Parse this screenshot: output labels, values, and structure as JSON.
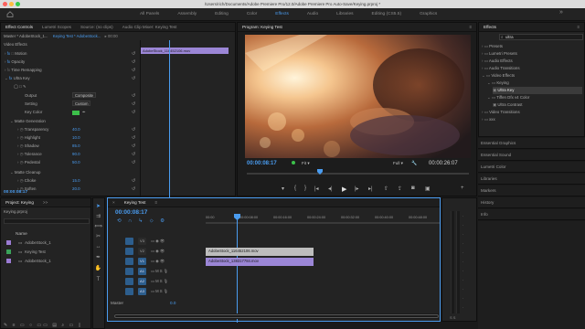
{
  "window": {
    "title": "/Users/rich/Documents/Adobe Premiere Pro/12.0/Adobe Premiere Pro Auto-Save/Keying.prproj *"
  },
  "workspaces": [
    "All Panels",
    "Assembly",
    "Editing",
    "Color",
    "Effects",
    "Audio",
    "Libraries",
    "Editing (CS5.5)",
    "Graphics"
  ],
  "effect_controls": {
    "tabs": [
      "Effect Controls",
      "Lumetri Scopes",
      "Source: (no clips)",
      "Audio Clip Mixer: Keying Test"
    ],
    "master": "Master * AdobeStock_1...",
    "sequence_clip": "Keying Test * AdobeStock...",
    "section": "Video Effects",
    "clip_bar": "AdobeStock_116452106.mov",
    "motion": "Motion",
    "opacity": "Opacity",
    "time_remapping": "Time Remapping",
    "ultra_key": "Ultra Key",
    "output_label": "Output",
    "output_value": "Composite",
    "setting_label": "Setting",
    "setting_value": "Custom",
    "key_color_label": "Key Color",
    "matte_generation": "Matte Generation",
    "params": [
      {
        "label": "Transparency",
        "value": "40.0"
      },
      {
        "label": "Highlight",
        "value": "10.0"
      },
      {
        "label": "Shadow",
        "value": "85.0"
      },
      {
        "label": "Tolerance",
        "value": "90.0"
      },
      {
        "label": "Pedestal",
        "value": "50.0"
      }
    ],
    "matte_cleanup": "Matte Cleanup",
    "cleanup": [
      {
        "label": "Choke",
        "value": "15.0"
      },
      {
        "label": "Soften",
        "value": "20.0"
      }
    ],
    "timecode": "00:00:08:17"
  },
  "program": {
    "title": "Program: Keying Test",
    "timecode": "00:00:08:17",
    "fit": "Fit",
    "quality": "Full",
    "duration": "00:00:26:07",
    "playhead_fraction": 0.33
  },
  "project": {
    "tabs": [
      "Project: Keying",
      ">>"
    ],
    "file": "Keying.prproj",
    "column": "Name",
    "items": [
      {
        "name": "AdobeStock_1",
        "color": "#9b7bd4"
      },
      {
        "name": "Keying Test",
        "color": "#3aa35a"
      },
      {
        "name": "AdobeStock_1",
        "color": "#9b7bd4"
      }
    ]
  },
  "timeline": {
    "tab": "Keying Test",
    "timecode": "00:00:08:17",
    "ruler": [
      "00:00",
      "00:00:08:00",
      "00:00:16:00",
      "00:00:24:00",
      "00:00:32:00",
      "00:00:40:00",
      "00:00:48:00"
    ],
    "tracks": [
      "V3",
      "V2",
      "V1",
      "A1",
      "A2",
      "A3"
    ],
    "master_label": "Master",
    "master_value": "0.0",
    "clips": [
      {
        "name": "AdobeStock_116452106.mov",
        "track": "V2"
      },
      {
        "name": "AdobeStock_138317784.mov",
        "track": "V1"
      }
    ]
  },
  "effects": {
    "title": "Effects",
    "search_value": "ultra",
    "items": [
      {
        "label": "Presets",
        "indent": 0
      },
      {
        "label": "Lumetri Presets",
        "indent": 0
      },
      {
        "label": "Audio Effects",
        "indent": 0
      },
      {
        "label": "Audio Transitions",
        "indent": 0
      },
      {
        "label": "Video Effects",
        "indent": 0
      },
      {
        "label": "Keying",
        "indent": 1
      },
      {
        "label": "Ultra Key",
        "indent": 2,
        "selected": true
      },
      {
        "label": "Tiffen Dfx v4 Color",
        "indent": 1
      },
      {
        "label": "Ultra Contrast",
        "indent": 2
      },
      {
        "label": "Video Transitions",
        "indent": 0
      },
      {
        "label": "xxx",
        "indent": 0
      }
    ],
    "panels": [
      "Essential Graphics",
      "Essential Sound",
      "Lumetri Color",
      "Libraries",
      "Markers",
      "History",
      "Info"
    ]
  },
  "colors": {
    "accent": "#4a9cf0",
    "clip_purple": "#9b86d6",
    "clip_gray": "#bdbdbd"
  }
}
